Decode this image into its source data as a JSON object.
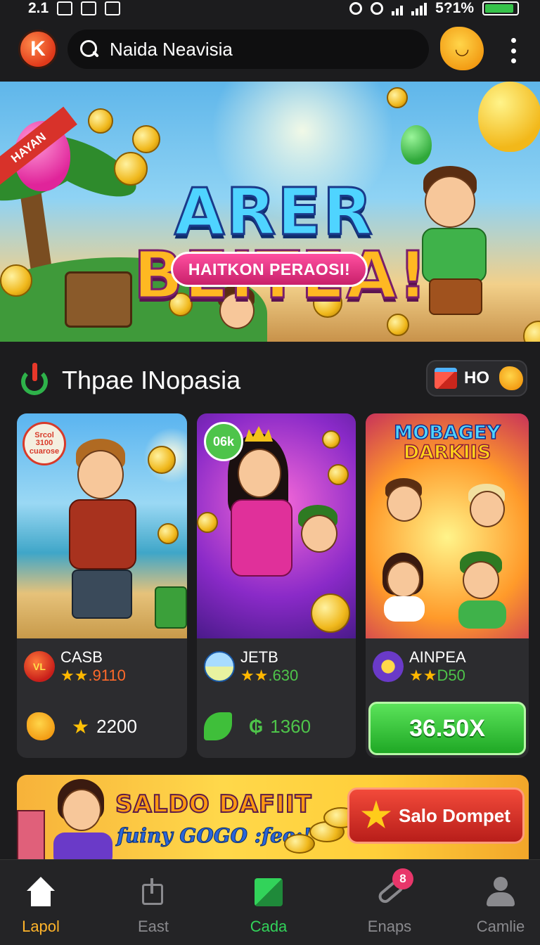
{
  "status_bar": {
    "time": "2.1",
    "battery_percent": "5?1%"
  },
  "header": {
    "search_text": "Naida Neavisia"
  },
  "hero": {
    "ribbon": "HAYAN",
    "title_line1": "ARER",
    "title_line2": "BEITEA!",
    "pill_text": "HAITKON PERAOSI!"
  },
  "section": {
    "title": "Thpae INopasia",
    "badge_text": "HO"
  },
  "cards": [
    {
      "corner_tag": "Srcol 3100 cuarose",
      "name": "CASB",
      "logo_text": "VL",
      "rating_value": ".9110",
      "bottom_value": "2200"
    },
    {
      "corner_tag": "06k",
      "name": "JETB",
      "rating_value": ".630",
      "bottom_value": "1360"
    },
    {
      "art_title_1": "MOBAGEY",
      "art_title_2": "DARKIIS",
      "name": "AINPEA",
      "rating_value": "D50",
      "button_label": "36.50X"
    }
  ],
  "promo": {
    "title": "SALDO DAFIIT",
    "subtitle": "fuiny GOGO :fee:!",
    "button_label": "Salo Dompet"
  },
  "bottom_nav": [
    {
      "label": "Lapol",
      "icon": "home-icon",
      "color": "#ffb42a"
    },
    {
      "label": "East",
      "icon": "share-icon",
      "color": "#8a8a8e"
    },
    {
      "label": "Cada",
      "icon": "cards-icon",
      "color": "#32d35a"
    },
    {
      "label": "Enaps",
      "icon": "link-icon",
      "color": "#8a8a8e",
      "badge": "8"
    },
    {
      "label": "Camlie",
      "icon": "profile-icon",
      "color": "#8a8a8e"
    }
  ]
}
